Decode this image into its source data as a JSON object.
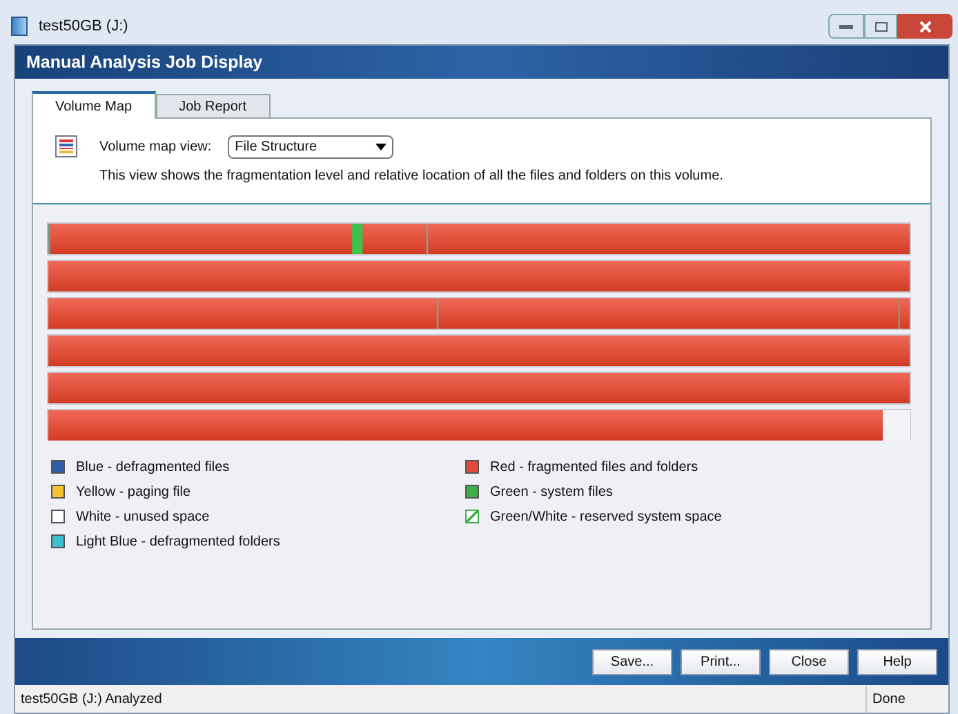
{
  "window": {
    "title": "test50GB (J:)"
  },
  "dialog": {
    "title": "Manual Analysis Job Display"
  },
  "tabs": [
    {
      "label": "Volume Map",
      "selected": true
    },
    {
      "label": "Job Report",
      "selected": false
    }
  ],
  "view": {
    "label": "Volume map view:",
    "value": "File Structure",
    "description": "This view shows the fragmentation level and relative location of all the files and folders on this volume."
  },
  "legend": [
    {
      "label": "Blue - defragmented files",
      "color": "#2f5fa8",
      "kind": "solid"
    },
    {
      "label": "Yellow - paging file",
      "color": "#f2c230",
      "kind": "solid"
    },
    {
      "label": "White - unused space",
      "color": "#ffffff",
      "kind": "solid"
    },
    {
      "label": "Light Blue - defragmented folders",
      "color": "#3cc0cf",
      "kind": "solid"
    },
    {
      "label": "Red - fragmented files and folders",
      "color": "#e2493a",
      "kind": "solid"
    },
    {
      "label": "Green - system files",
      "color": "#3fae49",
      "kind": "solid"
    },
    {
      "label": "Green/White - reserved system space",
      "color": "#3fae49",
      "kind": "hatched"
    }
  ],
  "buttons": [
    "Save...",
    "Print...",
    "Close",
    "Help"
  ],
  "status_bar": {
    "message": "test50GB (J:) Analyzed",
    "state": "Done"
  }
}
